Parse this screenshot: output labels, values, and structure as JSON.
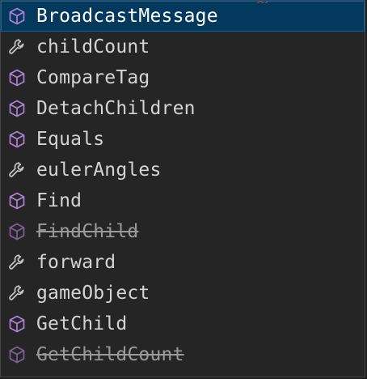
{
  "colors": {
    "method_icon": "#b180d7",
    "property_icon": "#c5c5c5",
    "selection_bg": "#04395e",
    "widget_bg": "#252526"
  },
  "suggestions": [
    {
      "label": "BroadcastMessage",
      "kind": "method",
      "icon": "cube-icon",
      "selected": true,
      "deprecated": false
    },
    {
      "label": "childCount",
      "kind": "property",
      "icon": "wrench-icon",
      "selected": false,
      "deprecated": false
    },
    {
      "label": "CompareTag",
      "kind": "method",
      "icon": "cube-icon",
      "selected": false,
      "deprecated": false
    },
    {
      "label": "DetachChildren",
      "kind": "method",
      "icon": "cube-icon",
      "selected": false,
      "deprecated": false
    },
    {
      "label": "Equals",
      "kind": "method",
      "icon": "cube-icon",
      "selected": false,
      "deprecated": false
    },
    {
      "label": "eulerAngles",
      "kind": "property",
      "icon": "wrench-icon",
      "selected": false,
      "deprecated": false
    },
    {
      "label": "Find",
      "kind": "method",
      "icon": "cube-icon",
      "selected": false,
      "deprecated": false
    },
    {
      "label": "FindChild",
      "kind": "method",
      "icon": "cube-icon",
      "selected": false,
      "deprecated": true
    },
    {
      "label": "forward",
      "kind": "property",
      "icon": "wrench-icon",
      "selected": false,
      "deprecated": false
    },
    {
      "label": "gameObject",
      "kind": "property",
      "icon": "wrench-icon",
      "selected": false,
      "deprecated": false
    },
    {
      "label": "GetChild",
      "kind": "method",
      "icon": "cube-icon",
      "selected": false,
      "deprecated": false
    },
    {
      "label": "GetChildCount",
      "kind": "method",
      "icon": "cube-icon",
      "selected": false,
      "deprecated": true
    }
  ]
}
